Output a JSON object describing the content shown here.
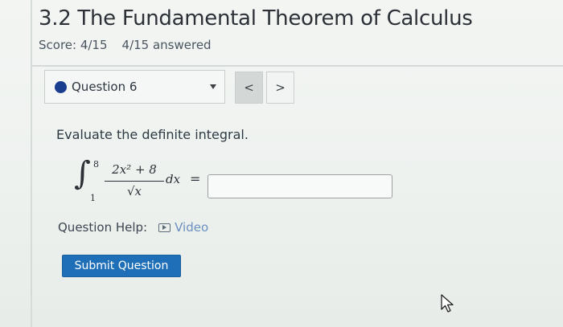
{
  "header": {
    "title": "3.2 The Fundamental Theorem of Calculus",
    "score": "Score: 4/15",
    "answered": "4/15 answered"
  },
  "question_nav": {
    "selected": "Question 6",
    "prev_label": "<",
    "next_label": ">"
  },
  "question": {
    "prompt": "Evaluate the definite integral.",
    "upper_limit": "8",
    "lower_limit": "1",
    "numerator": "2x² + 8",
    "denominator": "√x",
    "differential": "dx",
    "equals": "=",
    "answer_value": "",
    "answer_placeholder": ""
  },
  "help": {
    "label": "Question Help:",
    "video_label": "Video"
  },
  "actions": {
    "submit_label": "Submit Question"
  },
  "colors": {
    "accent_dot": "#1a3e8f",
    "submit_bg": "#1f6fb8",
    "link": "#6b8fc1"
  }
}
